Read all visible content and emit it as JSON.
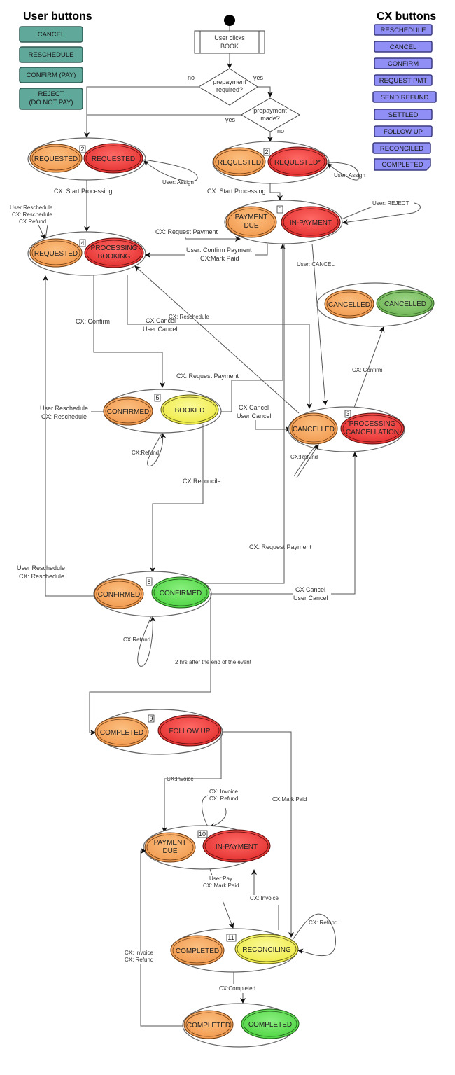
{
  "colors": {
    "user_button": "#5fa89a",
    "user_button_border": "#2e5a52",
    "cx_button": "#8f8ff5",
    "cx_button_border": "#3a3a80",
    "orange": "#f6a55f",
    "red": "#f0403f",
    "yellow": "#f7f35c",
    "green_light": "#66e05a",
    "green_dark": "#80c466"
  },
  "user_buttons": {
    "title": "User buttons",
    "items": [
      "CANCEL",
      "RESCHEDULE",
      "CONFIRM (PAY)",
      "REJECT",
      "(DO NOT PAY)"
    ]
  },
  "cx_buttons": {
    "title": "CX buttons",
    "items": [
      "RESCHEDULE",
      "CANCEL",
      "CONFIRM",
      "REQUEST PMT",
      "SEND REFUND",
      "SETTLED",
      "FOLLOW UP",
      "RECONCILED",
      "COMPLETED"
    ]
  },
  "start": {
    "action_line1": "User clicks",
    "action_line2": "BOOK"
  },
  "decisions": {
    "prepay_required": [
      "prepayment",
      "required?"
    ],
    "prepay_made": [
      "prepayment",
      "made?"
    ],
    "no": "no",
    "yes": "yes"
  },
  "states": {
    "s2a": {
      "num": "2",
      "user": "REQUESTED",
      "cx": "REQUESTED"
    },
    "s2b": {
      "num": "2",
      "user": "REQUESTED",
      "cx": "REQUESTED*"
    },
    "s4": {
      "num": "4",
      "user": "REQUESTED",
      "cx1": "PROCESSING",
      "cx2": "BOOKING"
    },
    "s6": {
      "num": "6",
      "user1": "PAYMENT",
      "user2": "DUE",
      "cx": "IN-PAYMENT"
    },
    "cancelled_final": {
      "user": "CANCELLED",
      "cx": "CANCELLED"
    },
    "s5": {
      "num": "5",
      "user": "CONFIRMED",
      "cx": "BOOKED"
    },
    "s3": {
      "num": "3",
      "user": "CANCELLED",
      "cx1": "PROCESSING",
      "cx2": "CANCELLATION"
    },
    "s8": {
      "num": "8",
      "user": "CONFIRMED",
      "cx": "CONFIRMED"
    },
    "s9": {
      "num": "9",
      "user": "COMPLETED",
      "cx": "FOLLOW UP"
    },
    "s10": {
      "num": "10",
      "user1": "PAYMENT",
      "user2": "DUE",
      "cx": "IN-PAYMENT"
    },
    "s11": {
      "num": "11",
      "user": "COMPLETED",
      "cx": "RECONCILING"
    },
    "final": {
      "user": "COMPLETED",
      "cx": "COMPLETED"
    }
  },
  "edge_labels": {
    "user_assign": "User: Assign",
    "cx_start_processing": "CX: Start Processing",
    "user_resched_1": "User Reschedule",
    "cx_resched_1": "CX: Reschedule",
    "cx_refund_1": "CX Refund",
    "cx_request_payment": "CX: Request Payment",
    "user_confirm_payment": "User: Confirm Payment",
    "cx_mark_paid": "CX:Mark Paid",
    "user_reject": "User: REJECT",
    "user_cancel": "User: CANCEL",
    "cx_confirm": "CX: Confirm",
    "cx_cancel": "CX Cancel",
    "user_cancel2": "User Cancel",
    "cx_reschedule": "CX: Reschedule",
    "cx_confirm2": "CX: Confirm",
    "user_reschedule": "User Reschedule",
    "cx_refund": "CX:Refund",
    "cx_reconcile": "CX Reconcile",
    "two_hrs": "2 hrs after the end of the event",
    "cx_invoice": "CX:Invoice",
    "cx_invoice_sp": "CX: Invoice",
    "cx_refund_sp": "CX: Refund",
    "cx_mark_paid2": "CX:Mark Paid",
    "user_pay": "User:Pay",
    "cx_mark_paid3": "CX: Mark Paid",
    "cx_completed": "CX:Completed"
  }
}
